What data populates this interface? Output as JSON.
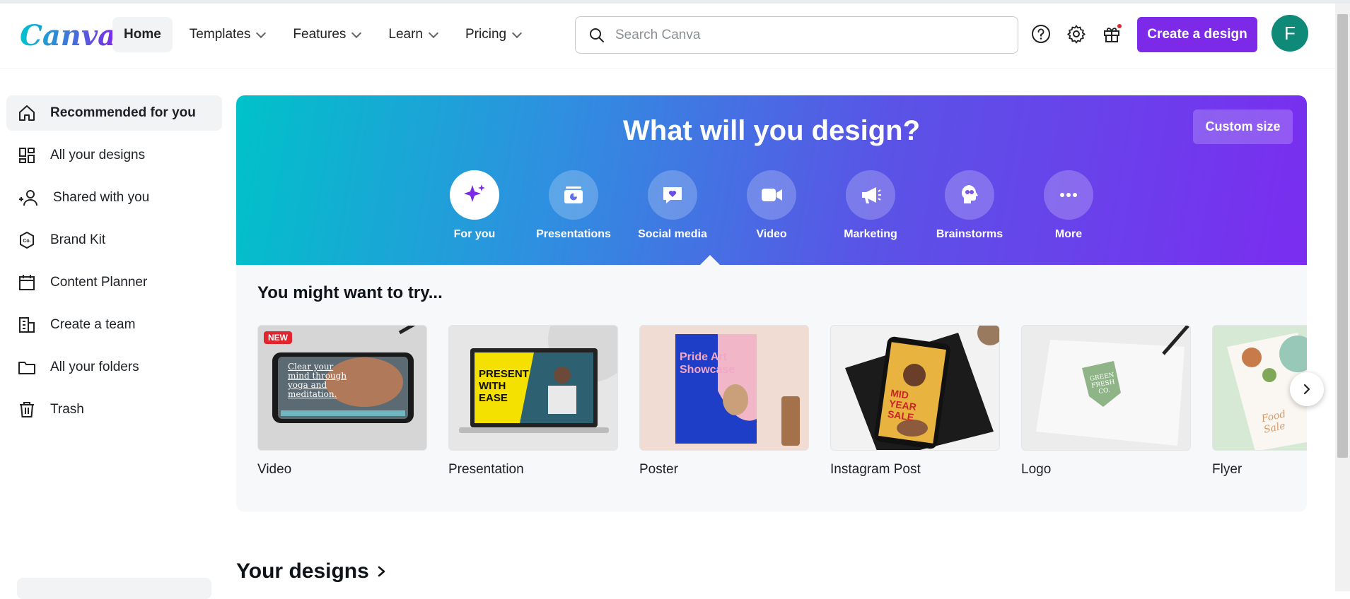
{
  "brand": {
    "logo_text": "Canva",
    "accent": "#7d2ae8"
  },
  "nav": {
    "items": [
      {
        "label": "Home"
      },
      {
        "label": "Templates"
      },
      {
        "label": "Features"
      },
      {
        "label": "Learn"
      },
      {
        "label": "Pricing"
      }
    ]
  },
  "search": {
    "placeholder": "Search Canva"
  },
  "header": {
    "create_label": "Create a design",
    "avatar_letter": "F"
  },
  "sidebar": {
    "items": [
      {
        "label": "Recommended for you",
        "icon": "home-icon"
      },
      {
        "label": "All your designs",
        "icon": "grid-icon"
      },
      {
        "label": "Shared with you",
        "icon": "users-icon"
      },
      {
        "label": "Brand Kit",
        "icon": "brand-kit-icon"
      },
      {
        "label": "Content Planner",
        "icon": "calendar-icon"
      },
      {
        "label": "Create a team",
        "icon": "building-icon"
      },
      {
        "label": "All your folders",
        "icon": "folder-icon"
      },
      {
        "label": "Trash",
        "icon": "trash-icon"
      }
    ]
  },
  "hero": {
    "title": "What will you design?",
    "custom_size_label": "Custom size",
    "categories": [
      {
        "label": "For you",
        "icon": "sparkle-icon"
      },
      {
        "label": "Presentations",
        "icon": "presentation-icon"
      },
      {
        "label": "Social media",
        "icon": "heart-chat-icon"
      },
      {
        "label": "Video",
        "icon": "video-camera-icon"
      },
      {
        "label": "Marketing",
        "icon": "megaphone-icon"
      },
      {
        "label": "Brainstorms",
        "icon": "lightbulb-head-icon"
      },
      {
        "label": "More",
        "icon": "more-dots-icon"
      }
    ]
  },
  "suggestions": {
    "title": "You might want to try...",
    "cards": [
      {
        "label": "Video",
        "badge": "NEW",
        "thumb_text": "Clear your mind through yoga and meditation."
      },
      {
        "label": "Presentation",
        "thumb_text": "PRESENT WITH EASE"
      },
      {
        "label": "Poster",
        "thumb_text": "Pride Art Showcase"
      },
      {
        "label": "Instagram Post",
        "thumb_text": "MID YEAR SALE"
      },
      {
        "label": "Logo",
        "thumb_text": "GREEN FRESH CO."
      },
      {
        "label": "Flyer",
        "thumb_text": "Food Sale"
      }
    ]
  },
  "your_designs": {
    "title": "Your designs"
  }
}
